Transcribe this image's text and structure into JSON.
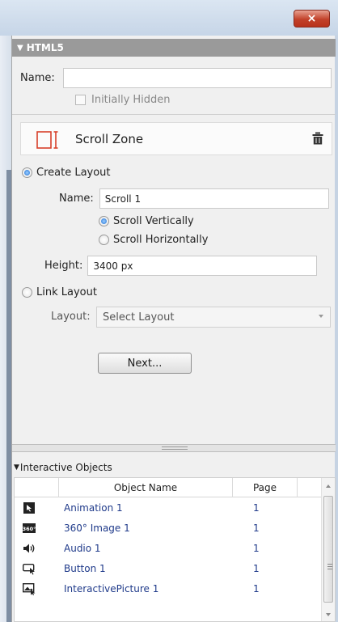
{
  "window": {
    "close_symbol": "×"
  },
  "html5": {
    "header_label": "HTML5",
    "name_label": "Name:",
    "name_value": "",
    "initially_hidden_label": "Initially Hidden",
    "initially_hidden_checked": false
  },
  "scroll_zone": {
    "title": "Scroll Zone",
    "icon": "scroll-zone-icon",
    "delete_icon": "trash-icon",
    "create_layout_label": "Create Layout",
    "create_layout_selected": true,
    "layout_name_label": "Name:",
    "layout_name_value": "Scroll 1",
    "scroll_vertically_label": "Scroll Vertically",
    "scroll_horizontally_label": "Scroll Horizontally",
    "selected_direction": "vertical",
    "height_label": "Height:",
    "height_value": "3400 px",
    "link_layout_label": "Link Layout",
    "layout_label": "Layout:",
    "layout_select_value": "Select Layout",
    "next_button_label": "Next..."
  },
  "interactive_objects": {
    "header_label": "Interactive Objects",
    "columns": {
      "name": "Object Name",
      "page": "Page"
    },
    "rows": [
      {
        "icon": "animation-icon",
        "name": "Animation 1",
        "page": "1"
      },
      {
        "icon": "360-image-icon",
        "name": "360° Image 1",
        "page": "1"
      },
      {
        "icon": "audio-icon",
        "name": "Audio 1",
        "page": "1"
      },
      {
        "icon": "button-icon",
        "name": "Button 1",
        "page": "1"
      },
      {
        "icon": "interactive-picture-icon",
        "name": "InteractivePicture 1",
        "page": "1"
      }
    ]
  },
  "colors": {
    "accent_red": "#d8402a",
    "link_blue": "#1f3a8a",
    "header_gray": "#9a9a9a"
  }
}
